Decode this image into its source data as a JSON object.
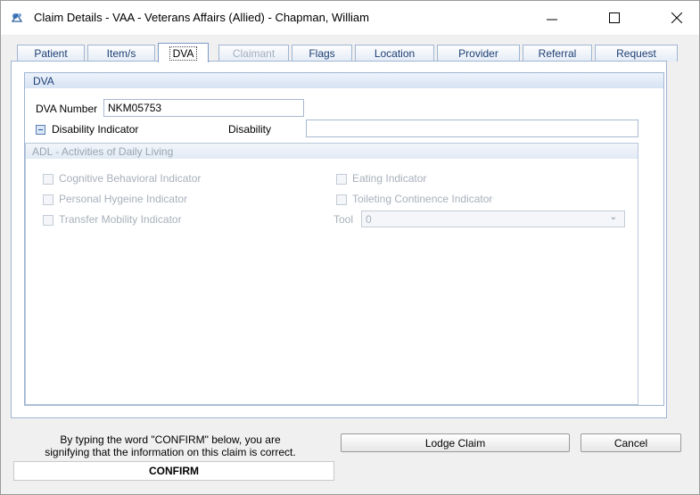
{
  "window": {
    "title": "Claim Details - VAA - Veterans Affairs (Allied) - Chapman, William",
    "app_icon": "allied-app-icon",
    "controls": {
      "minimize": "—",
      "maximize": "☐",
      "close": "✕"
    }
  },
  "tabs": [
    {
      "label": "Patient",
      "state": "normal"
    },
    {
      "label": "Item/s",
      "state": "normal"
    },
    {
      "label": "DVA",
      "state": "active"
    },
    {
      "label": "Claimant",
      "state": "disabled"
    },
    {
      "label": "Flags",
      "state": "normal"
    },
    {
      "label": "Location",
      "state": "normal"
    },
    {
      "label": "Provider",
      "state": "normal"
    },
    {
      "label": "Referral",
      "state": "normal"
    },
    {
      "label": "Request",
      "state": "normal"
    }
  ],
  "dva": {
    "group_title": "DVA",
    "dva_number_label": "DVA Number",
    "dva_number_value": "NKM05753",
    "disability_indicator_label": "Disability Indicator",
    "disability_label": "Disability",
    "disability_value": ""
  },
  "adl": {
    "title": "ADL - Activities of Daily Living",
    "cognitive": "Cognitive Behavioral Indicator",
    "hygeine": "Personal Hygeine Indicator",
    "transfer": "Transfer Mobility Indicator",
    "eating": "Eating Indicator",
    "toileting": "Toileting Continence Indicator",
    "tool_label": "Tool",
    "tool_value": "0"
  },
  "footer": {
    "confirm_line1": "By typing the word \"CONFIRM\" below, you are",
    "confirm_line2": "signifying that the information on this claim is correct.",
    "confirm_value": "CONFIRM",
    "lodge_label": "Lodge Claim",
    "cancel_label": "Cancel"
  },
  "colors": {
    "accent_border": "#9fb5d3",
    "tab_text": "#1e3f74",
    "disabled_text": "#a8b0bb"
  }
}
